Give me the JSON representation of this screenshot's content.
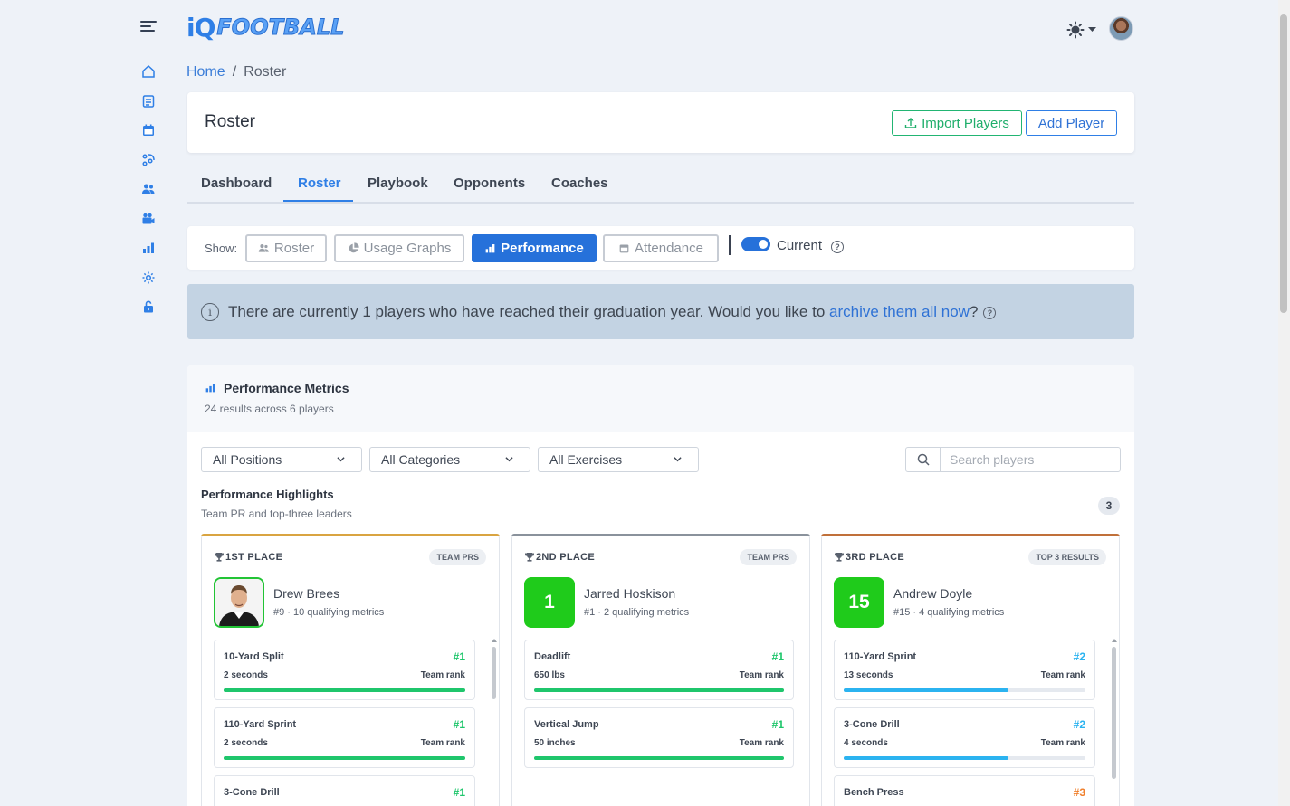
{
  "app": {
    "logo_prefix": "iQ",
    "logo_word": "FOOTBALL"
  },
  "breadcrumb": {
    "home": "Home",
    "separator": "/",
    "current": "Roster"
  },
  "header": {
    "title": "Roster",
    "import_label": "Import Players",
    "add_label": "Add Player"
  },
  "tabs": [
    {
      "label": "Dashboard",
      "active": false
    },
    {
      "label": "Roster",
      "active": true
    },
    {
      "label": "Playbook",
      "active": false
    },
    {
      "label": "Opponents",
      "active": false
    },
    {
      "label": "Coaches",
      "active": false
    }
  ],
  "show_bar": {
    "label": "Show:",
    "buttons": [
      {
        "label": "Roster",
        "icon": "users-icon",
        "active": false
      },
      {
        "label": "Usage Graphs",
        "icon": "pie-chart-icon",
        "active": false
      },
      {
        "label": "Performance",
        "icon": "bar-chart-icon",
        "active": true
      },
      {
        "label": "Attendance",
        "icon": "calendar-icon",
        "active": false
      }
    ],
    "toggle_label": "Current",
    "toggle_on": true,
    "help": "?"
  },
  "alert": {
    "text": "There are currently 1 players who have reached their graduation year. Would you like to ",
    "link": "archive them all now",
    "suffix": "?",
    "icon": "i"
  },
  "performance": {
    "title": "Performance Metrics",
    "subtitle": "24 results across 6 players",
    "filters": [
      "All Positions",
      "All Categories",
      "All Exercises"
    ],
    "search_placeholder": "Search players",
    "highlights_title": "Performance Highlights",
    "highlights_subtitle": "Team PR and top-three leaders",
    "highlights_count": "3"
  },
  "places": [
    {
      "label": "1ST PLACE",
      "badge": "TEAM PRS",
      "accent": "#d9a441",
      "player_name": "Drew Brees",
      "player_meta": "#9 · 10 qualifying metrics",
      "avatar_number": "",
      "metrics": [
        {
          "name": "10-Yard Split",
          "rank": "#1",
          "value": "2 seconds",
          "sub": "Team rank",
          "fill": 1.0,
          "color": "#1fc66c"
        },
        {
          "name": "110-Yard Sprint",
          "rank": "#1",
          "value": "2 seconds",
          "sub": "Team rank",
          "fill": 1.0,
          "color": "#1fc66c"
        },
        {
          "name": "3-Cone Drill",
          "rank": "#1",
          "value": "",
          "sub": "",
          "fill": 1.0,
          "color": "#1fc66c"
        }
      ]
    },
    {
      "label": "2ND PLACE",
      "badge": "TEAM PRS",
      "accent": "#8a929c",
      "player_name": "Jarred Hoskison",
      "player_meta": "#1 · 2 qualifying metrics",
      "avatar_number": "1",
      "metrics": [
        {
          "name": "Deadlift",
          "rank": "#1",
          "value": "650 lbs",
          "sub": "Team rank",
          "fill": 1.0,
          "color": "#1fc66c"
        },
        {
          "name": "Vertical Jump",
          "rank": "#1",
          "value": "50 inches",
          "sub": "Team rank",
          "fill": 1.0,
          "color": "#1fc66c"
        }
      ]
    },
    {
      "label": "3RD PLACE",
      "badge": "TOP 3 RESULTS",
      "accent": "#c0703a",
      "player_name": "Andrew Doyle",
      "player_meta": "#15 · 4 qualifying metrics",
      "avatar_number": "15",
      "metrics": [
        {
          "name": "110-Yard Sprint",
          "rank": "#2",
          "value": "13 seconds",
          "sub": "Team rank",
          "fill": 0.68,
          "color": "#2bb3f0"
        },
        {
          "name": "3-Cone Drill",
          "rank": "#2",
          "value": "4 seconds",
          "sub": "Team rank",
          "fill": 0.68,
          "color": "#2bb3f0"
        },
        {
          "name": "Bench Press",
          "rank": "#3",
          "value": "",
          "sub": "",
          "fill": 0.35,
          "color": "#f07f2b"
        }
      ]
    }
  ]
}
